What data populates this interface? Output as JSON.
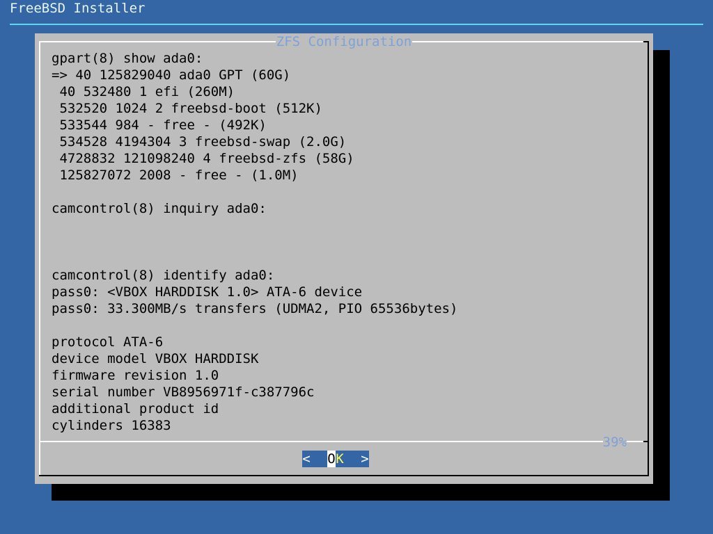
{
  "backtitle": "FreeBSD Installer",
  "dialog": {
    "title": "ZFS Configuration",
    "lines": [
      "gpart(8) show ada0:",
      "=> 40 125829040 ada0 GPT (60G)",
      " 40 532480 1 efi (260M)",
      " 532520 1024 2 freebsd-boot (512K)",
      " 533544 984 - free - (492K)",
      " 534528 4194304 3 freebsd-swap (2.0G)",
      " 4728832 121098240 4 freebsd-zfs (58G)",
      " 125827072 2008 - free - (1.0M)",
      "",
      "camcontrol(8) inquiry ada0:",
      "",
      "",
      "",
      "camcontrol(8) identify ada0:",
      "pass0: <VBOX HARDDISK 1.0> ATA-6 device",
      "pass0: 33.300MB/s transfers (UDMA2, PIO 65536bytes)",
      "",
      "protocol ATA-6",
      "device model VBOX HARDDISK",
      "firmware revision 1.0",
      "serial number VB8956971f-c387796c",
      "additional product id",
      "cylinders 16383"
    ],
    "scroll_percent": "39%",
    "ok_button": {
      "left_bracket": "<",
      "hotkey": "O",
      "rest": "K",
      "right_bracket": ">"
    }
  },
  "colors": {
    "background": "#3465a4",
    "dialog": "#bdbdbd",
    "title": "#7ea2d6",
    "backtitle_rule": "#5fd7ef",
    "hotkey_text": "#ffff55"
  }
}
